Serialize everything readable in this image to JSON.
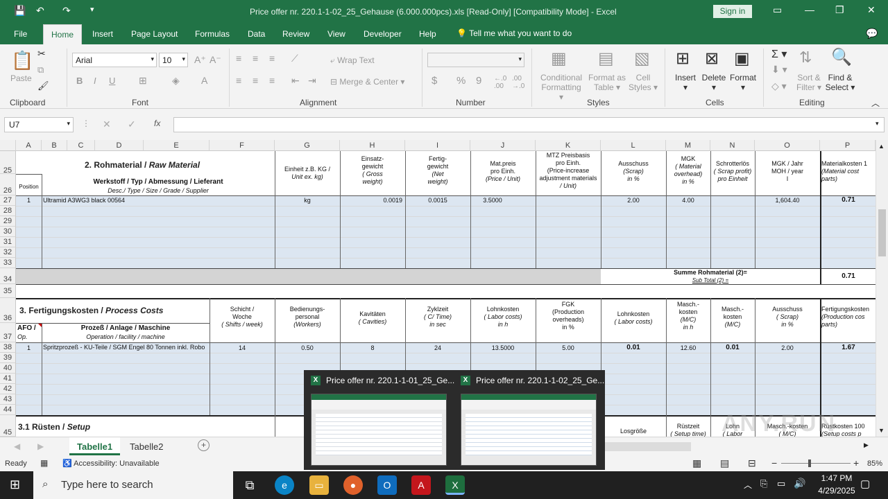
{
  "window": {
    "title": "Price offer nr. 220.1-1-02_25_Gehause (6.000.000pcs).xls  [Read-Only]  [Compatibility Mode]  -  Excel",
    "sign_in": "Sign in"
  },
  "menu": {
    "items": [
      "File",
      "Home",
      "Insert",
      "Page Layout",
      "Formulas",
      "Data",
      "Review",
      "View",
      "Developer",
      "Help"
    ],
    "tell_me": "Tell me what you want to do"
  },
  "ribbon": {
    "clipboard": {
      "label": "Clipboard",
      "paste": "Paste"
    },
    "font": {
      "label": "Font",
      "name": "Arial",
      "size": "10",
      "bold": "B",
      "italic": "I",
      "underline": "U"
    },
    "alignment": {
      "label": "Alignment",
      "wrap": "Wrap Text",
      "merge": "Merge & Center"
    },
    "number": {
      "label": "Number",
      "format": "",
      "currency": "$",
      "percent": "%",
      "comma": "9"
    },
    "styles": {
      "label": "Styles",
      "cond_top": "Conditional",
      "cond_bottom": "Formatting",
      "table_top": "Format as",
      "table_bottom": "Table",
      "cell_top": "Cell",
      "cell_bottom": "Styles"
    },
    "cells": {
      "label": "Cells",
      "insert": "Insert",
      "delete": "Delete",
      "format": "Format"
    },
    "editing": {
      "label": "Editing",
      "sort_top": "Sort &",
      "sort_bottom": "Filter",
      "find_top": "Find &",
      "find_bottom": "Select"
    }
  },
  "formula_bar": {
    "name_box": "U7",
    "fx": "fx",
    "content": ""
  },
  "columns": [
    "A",
    "B",
    "C",
    "D",
    "E",
    "F",
    "G",
    "H",
    "I",
    "J",
    "K",
    "L",
    "M",
    "N",
    "O",
    "P"
  ],
  "rows": [
    "25",
    "26",
    "27",
    "28",
    "29",
    "30",
    "31",
    "32",
    "33",
    "34",
    "35",
    "36",
    "37",
    "38",
    "39",
    "40",
    "41",
    "42",
    "43",
    "44",
    "45"
  ],
  "sheet": {
    "sec2_title": "2. Rohmaterial / ",
    "sec2_title_it": "Raw Material",
    "position": "Position",
    "werkstoff": "Werkstoff / Typ / Abmessung / Lieferant",
    "werkstoff_sub": "Desc./ Type / Size / Grade / Supplier",
    "einheit": "Einheit z.B. KG  /",
    "einheit_it": "Unit ex. kg)",
    "einsatz": "Einsatz-",
    "einsatz2": "gewicht",
    "einsatz_it": "( Gross",
    "einsatz_it2": "weight)",
    "fertig": "Fertig-",
    "fertig2": "gewicht",
    "fertig_it": "(Net",
    "fertig_it2": "weight)",
    "matpreis": "Mat.preis",
    "matpreis2": "pro Einh.",
    "matpreis_it": "(Price / Unit)",
    "mtz": "MTZ Preisbasis",
    "mtz2": "pro Einh.",
    "mtz3": "(Price-increase",
    "mtz4": "adjustment  materials",
    "mtz5": "/ Unit)",
    "ausschuss": "Ausschuss",
    "ausschuss_it": "(Scrap)",
    "ausschuss_it2": "in %",
    "mgk": "MGK",
    "mgk_it": "( Material",
    "mgk_it2": "overhead)",
    "mgk_it3": "in %",
    "schrott": "Schrotterlös",
    "schrott_it": "( Scrap profit)",
    "schrott_it2": "pro Einheit",
    "mgkjahr": "MGK / Jahr",
    "mgkjahr2": "MOH / year",
    "mgkjahr3": "I",
    "matkosten": "Materialkosten 1",
    "matkosten_it": "(Material cost",
    "matkosten_it2": "parts)",
    "r27": {
      "pos": "1",
      "desc": "Ultramid A3WG3 black 00564",
      "unit": "kg",
      "gross": "0.0019",
      "net": "0.0015",
      "price": "3.5000",
      "scrap": "2.00",
      "mgk": "4.00",
      "moh": "1,604.40",
      "cost": "0.71"
    },
    "sum_label": "Summe Rohmaterial (2)=",
    "sum_label_it": "Sub Total (2) =",
    "sum_value": "0.71",
    "sec3_title": "3. Fertigungskosten / ",
    "sec3_title_it": "Process Costs",
    "schicht": "Schicht /",
    "schicht2": "Woche",
    "schicht_it": "( Shifts / week)",
    "bedien": "Bedienungs-",
    "bedien2": "personal",
    "bedien_it": "(Workers)",
    "kav": "Kavitäten",
    "kav_it": "( Cavities)",
    "zyk": "Zyklzeit",
    "zyk_it": "( C/ Time)",
    "zyk_it2": "in sec",
    "lohn": "Lohnkosten",
    "lohn_it": "( Labor costs)",
    "lohn_it2": "in h",
    "fgk": "FGK",
    "fgk2": "(Production",
    "fgk3": "overheads)",
    "fgk4": "in %",
    "lohn2": "Lohnkosten",
    "lohn2_it": "( Labor costs)",
    "masch": "Masch.-",
    "masch2": "kosten",
    "masch_it": "(M/C)",
    "masch_it2": "in h",
    "masch3": "Masch.-",
    "masch4": "kosten",
    "masch4_it": "(M/C)",
    "aus2": "Ausschuss",
    "aus2_it": "( Scrap)",
    "aus2_it2": "in %",
    "fert": "Fertigungskosten",
    "fert_it": "(Production cos",
    "fert_it2": "parts)",
    "afo": "AFO /",
    "afo_it": "Op.",
    "prozess": "Prozeß / Anlage / Maschine",
    "prozess_it": "Operation / facility / machine",
    "r38": {
      "pos": "1",
      "desc": "Spritzprozeß - KU-Teile / SGM Engel 80 Tonnen inkl. Robo",
      "shifts": "14",
      "workers": "0.50",
      "cav": "8",
      "cycle": "24",
      "labor": "13.5000",
      "fgk": "5.00",
      "laborc": "0.01",
      "mc": "12.60",
      "mcc": "0.01",
      "scrap": "2.00",
      "cost": "1.67"
    },
    "sec31_title": "3.1 Rüsten / ",
    "sec31_title_it": "Setup",
    "losgroesse": "Losgröße",
    "ruestzeit": "Rüstzeit",
    "ruestzeit_it": "( Setup time)",
    "lohn3": "Lohn",
    "lohn3_it": "( Labor",
    "maschk": "Masch.-kosten",
    "maschk_it": "( M/C)",
    "ruestk": "Rüstkosten 100",
    "ruestk_it": "(Setup costs p"
  },
  "sheets": {
    "tab1": "Tabelle1",
    "tab2": "Tabelle2",
    "add": "+"
  },
  "status": {
    "ready": "Ready",
    "accessibility": "Accessibility: Unavailable",
    "zoom": "85%"
  },
  "popup": {
    "item1": "Price offer nr. 220.1-1-01_25_Ge...",
    "item2": "Price offer nr. 220.1-1-02_25_Ge..."
  },
  "taskbar": {
    "search": "Type here to search",
    "time": "1:47 PM",
    "date": "4/29/2025"
  },
  "watermark": "ANY.RUN"
}
